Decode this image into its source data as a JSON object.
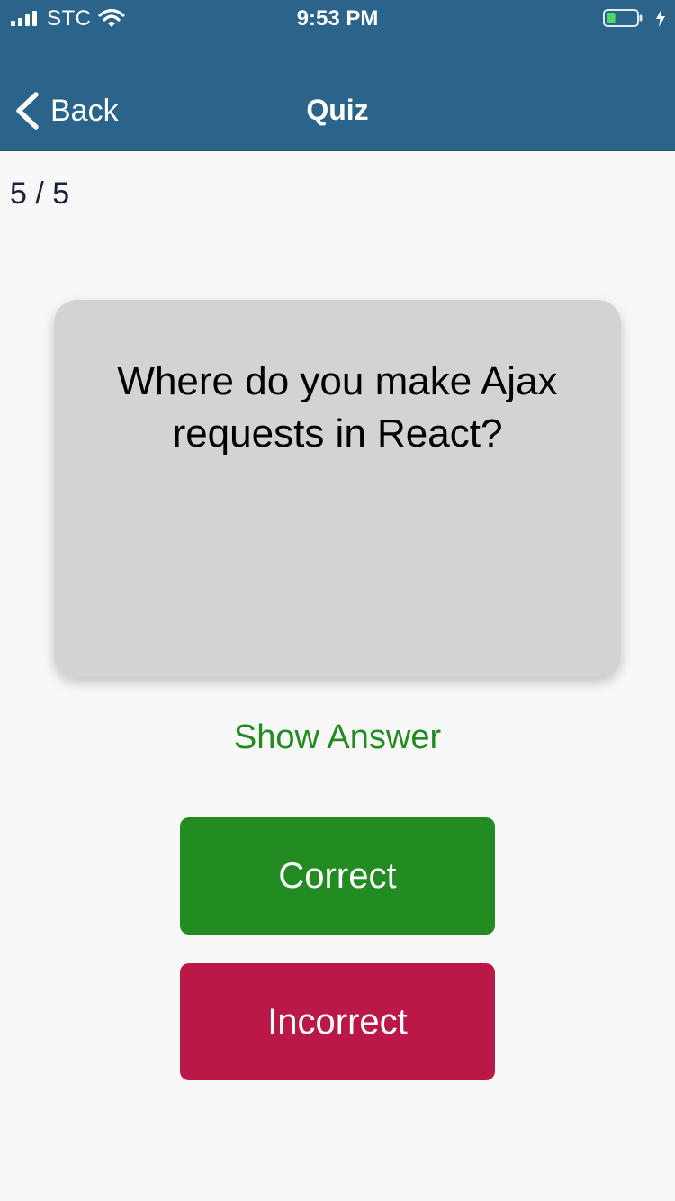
{
  "status_bar": {
    "carrier": "STC",
    "time": "9:53 PM",
    "signal_bars": 4,
    "battery_level": 0.3,
    "icons": [
      "signal-icon",
      "wifi-icon",
      "battery-icon",
      "charging-bolt-icon"
    ]
  },
  "nav": {
    "back_label": "Back",
    "title": "Quiz"
  },
  "quiz": {
    "progress": "5 / 5",
    "question": "Where do you make Ajax requests in React?",
    "show_answer_label": "Show Answer",
    "correct_label": "Correct",
    "incorrect_label": "Incorrect"
  },
  "colors": {
    "header_bg": "#2a648b",
    "page_bg": "#f8f8f8",
    "card_bg": "#d3d3d3",
    "show_answer_text": "#228b22",
    "correct_bg": "#228b22",
    "incorrect_bg": "#ba1948",
    "battery_fill": "#4cd964"
  }
}
